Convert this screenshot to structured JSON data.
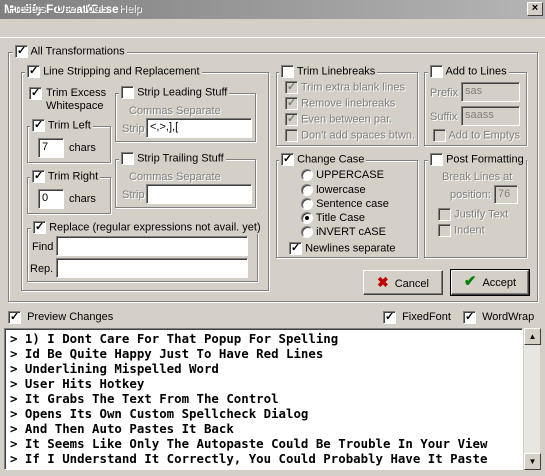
{
  "window": {
    "title": "Modify Format/Case",
    "close_glyph": "×"
  },
  "menu": [
    "Presets",
    "User Tools",
    "Help"
  ],
  "all_transformations": {
    "label": "All Transformations",
    "checked": true
  },
  "line_stripping": {
    "label": "Line Stripping and Replacement",
    "trim_excess": {
      "label1": "Trim Excess",
      "label2": "Whitespace"
    },
    "trim_left": {
      "label": "Trim Left",
      "value": "7",
      "unit": "chars"
    },
    "trim_right": {
      "label": "Trim Right",
      "value": "0",
      "unit": "chars"
    },
    "strip_leading": {
      "label": "Strip Leading Stuff",
      "hint": "Commas Separate",
      "field_label": "Strip",
      "value": "<,>,],["
    },
    "strip_trailing": {
      "label": "Strip Trailing Stuff",
      "hint": "Commas Separate",
      "field_label": "Strip",
      "value": ""
    },
    "replace": {
      "label": "Replace (regular expressions not avail. yet)",
      "find_label": "Find",
      "find_value": "",
      "rep_label": "Rep.",
      "rep_value": ""
    }
  },
  "trim_linebreaks": {
    "label": "Trim Linebreaks",
    "options": [
      "Trim extra blank lines",
      "Remove linebreaks",
      "Even between par.",
      "Don't add spaces btwn."
    ]
  },
  "add_to_lines": {
    "label": "Add to Lines",
    "prefix_label": "Prefix",
    "prefix_value": "sas",
    "suffix_label": "Suffix",
    "suffix_value": "saass",
    "empty_label": "Add to Emptys"
  },
  "change_case": {
    "label": "Change Case",
    "options": [
      "UPPERCASE",
      "lowercase",
      "Sentence case",
      "Title Case",
      "iNVERT cASE"
    ],
    "selected": "Title Case",
    "newlines_label": "Newlines separate"
  },
  "post_formatting": {
    "label": "Post Formatting",
    "break_label1": "Break Lines at",
    "break_label2": "position:",
    "break_value": "76",
    "justify_label": "Justify Text",
    "indent_label": "Indent"
  },
  "buttons": {
    "cancel": "Cancel",
    "accept": "Accept"
  },
  "preview_bar": {
    "preview_label": "Preview Changes",
    "fixedfont_label": "FixedFont",
    "wordwrap_label": "WordWrap"
  },
  "preview_lines": [
    "> 1) I Dont Care For That Popup For Spelling",
    "> Id Be Quite Happy Just To Have Red Lines",
    "> Underlining Mispelled Word",
    "> User Hits Hotkey",
    "> It Grabs The Text From The Control",
    "> Opens Its Own Custom Spellcheck Dialog",
    "> And Then Auto Pastes It Back",
    "> It Seems Like Only The Autopaste Could Be Trouble In Your View",
    "> If I Understand It Correctly, You Could Probably Have It Paste"
  ]
}
